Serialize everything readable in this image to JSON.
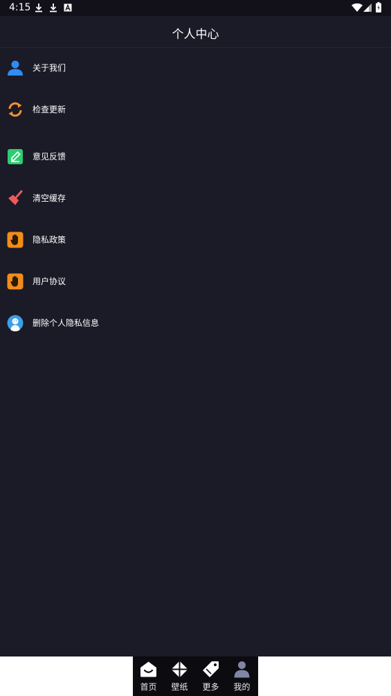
{
  "status_bar": {
    "time": "4:15"
  },
  "header": {
    "title": "个人中心"
  },
  "menu": [
    {
      "label": "关于我们",
      "icon": "person-icon",
      "color": "#2f8cf5"
    },
    {
      "label": "检查更新",
      "icon": "refresh-icon",
      "color": "#f29330"
    },
    {
      "label": "意见反馈",
      "icon": "edit-icon",
      "color": "#2ecc71"
    },
    {
      "label": "清空缓存",
      "icon": "broom-icon",
      "color": "#ef5b5b"
    },
    {
      "label": "隐私政策",
      "icon": "hand-icon",
      "color": "#f28c1a"
    },
    {
      "label": "用户协议",
      "icon": "hand-icon",
      "color": "#f28c1a"
    },
    {
      "label": "删除个人隐私信息",
      "icon": "avatar-icon",
      "color": "#3aa0e8"
    }
  ],
  "tabbar": [
    {
      "label": "首页",
      "icon": "home-icon"
    },
    {
      "label": "壁纸",
      "icon": "wallpaper-icon"
    },
    {
      "label": "更多",
      "icon": "tags-icon"
    },
    {
      "label": "我的",
      "icon": "profile-icon"
    }
  ]
}
